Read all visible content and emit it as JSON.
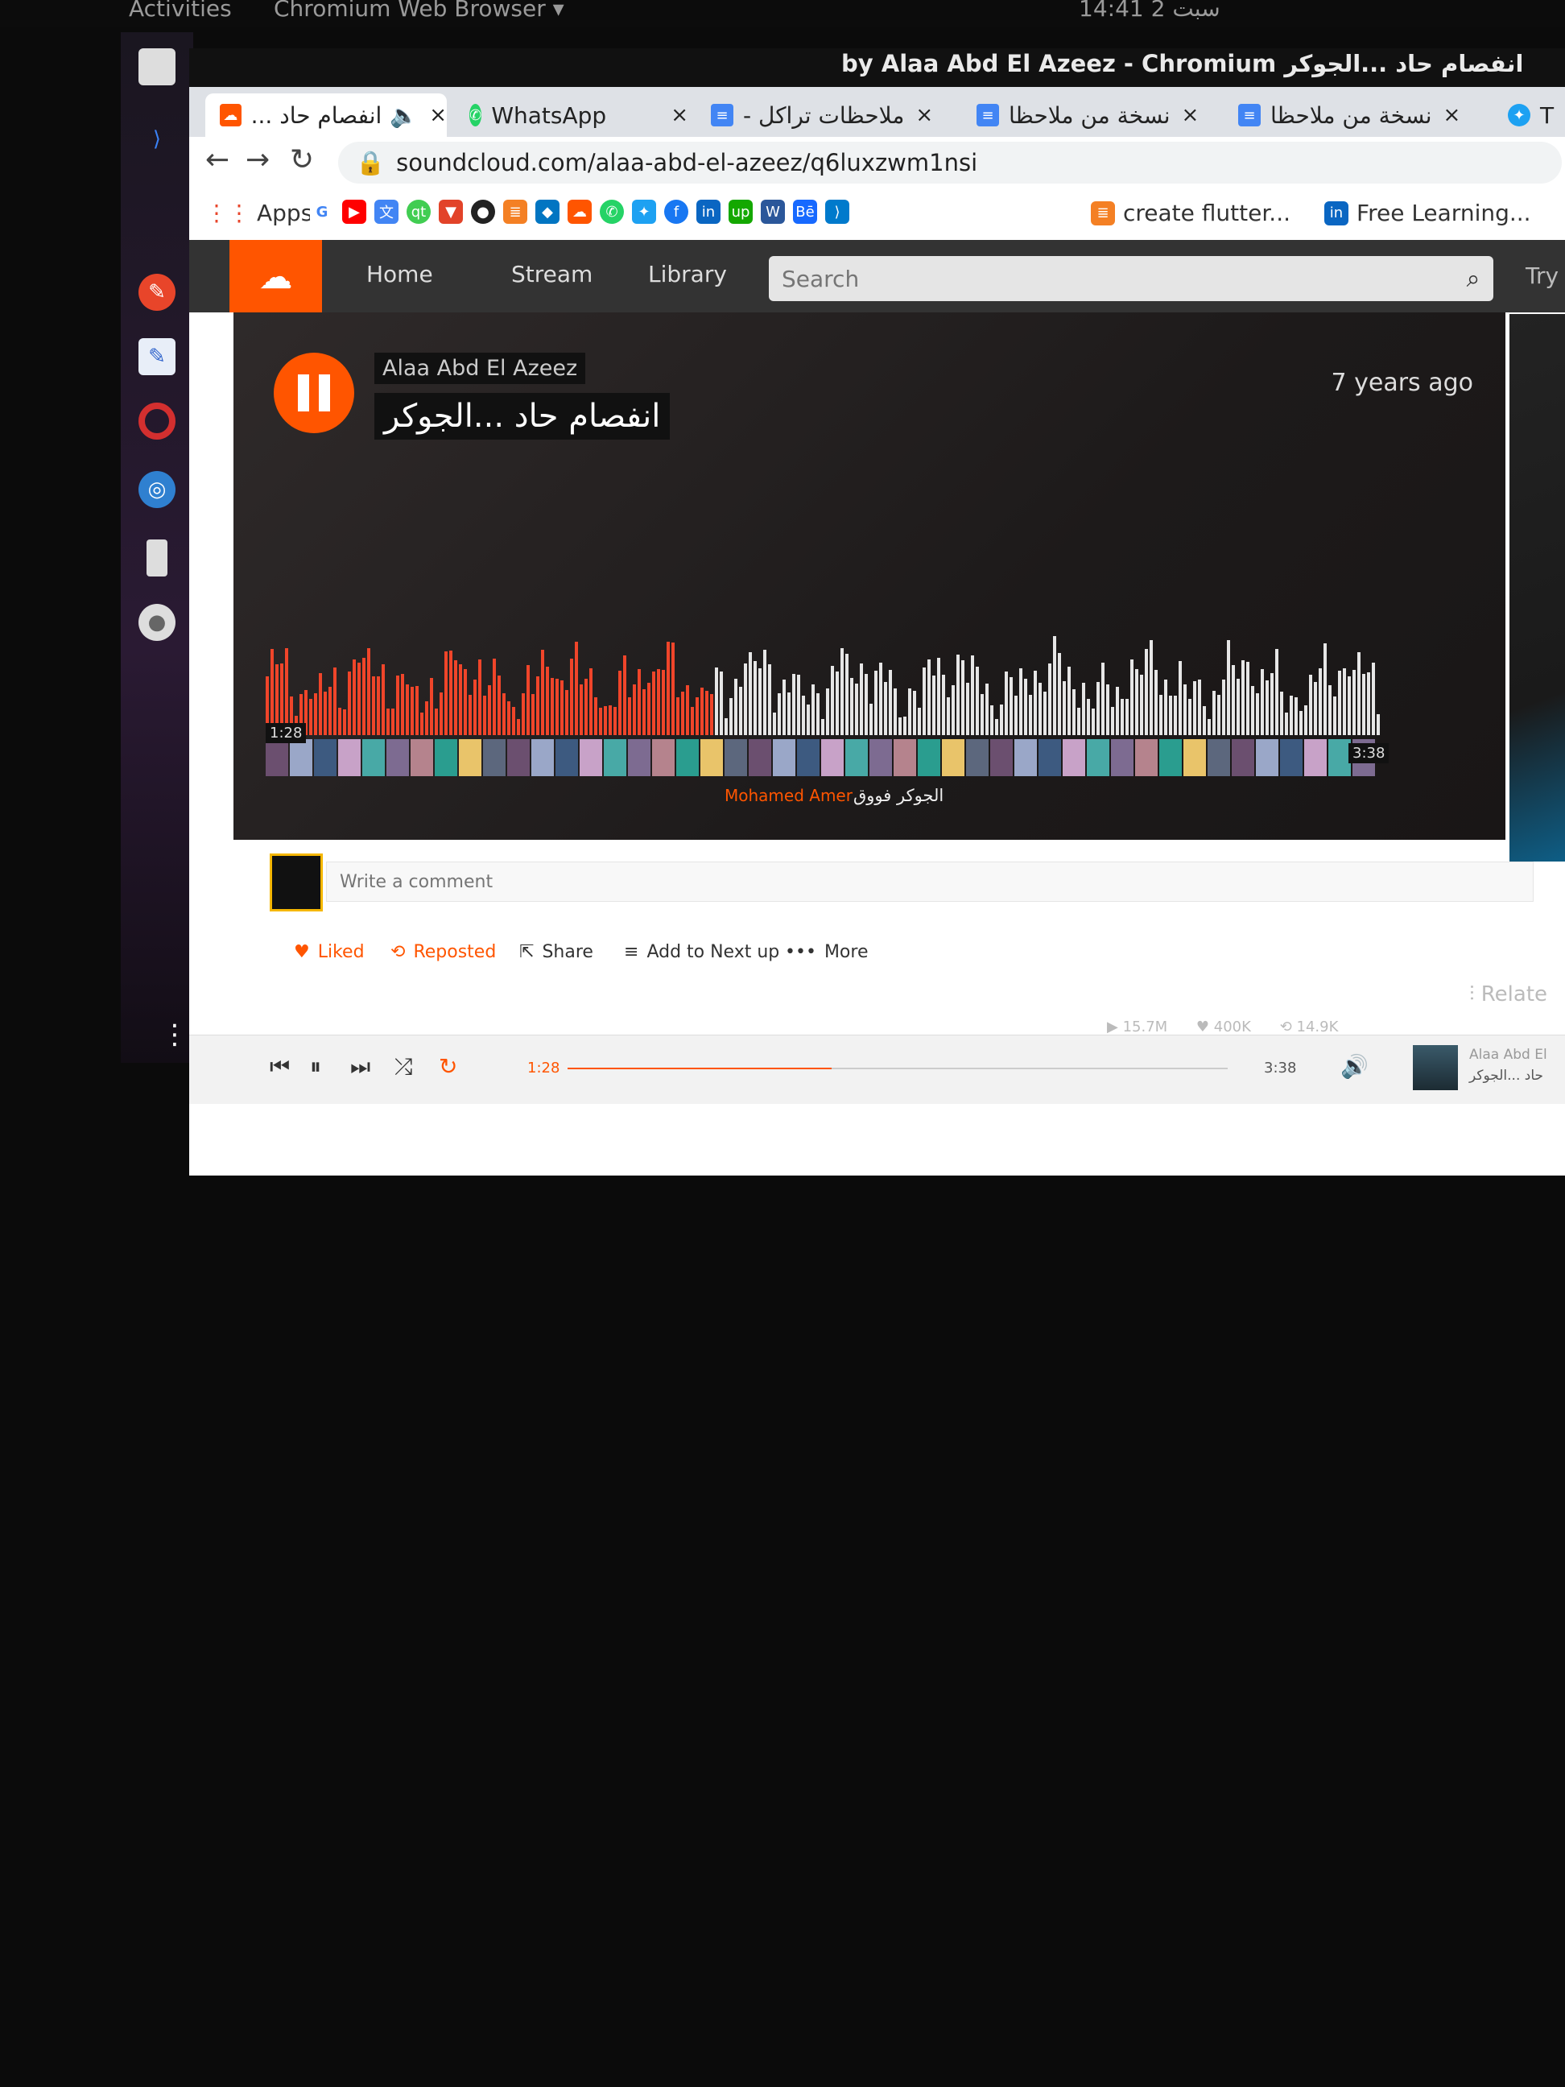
{
  "system": {
    "activities": "Activities",
    "app_menu": "Chromium Web Browser ▾",
    "clock": "14:41 2 سبت"
  },
  "window": {
    "title": "by Alaa Abd El Azeez - Chromium انفصام حاد ...الجوكر"
  },
  "tabs": [
    {
      "label": "انفصام حاد ...",
      "color": "#f50"
    },
    {
      "label": "WhatsApp",
      "color": "#25d366"
    },
    {
      "label": "ملاحظات تراكل -",
      "color": "#4285f4"
    },
    {
      "label": "نسخة من ملاحظا",
      "color": "#4285f4"
    },
    {
      "label": "نسخة من ملاحظا",
      "color": "#4285f4"
    },
    {
      "label": "T",
      "color": "#1da1f2"
    }
  ],
  "address_bar": {
    "url": "soundcloud.com/alaa-abd-el-azeez/q6luxzwm1nsi"
  },
  "bookmarks": {
    "apps_label": "Apps",
    "items": [
      {
        "label": "create flutter...",
        "icon": "stackoverflow-icon",
        "color": "#f48024"
      },
      {
        "label": "Free Learning...",
        "icon": "linkedin-icon",
        "color": "#0a66c2"
      }
    ]
  },
  "soundcloud": {
    "nav": {
      "home": "Home",
      "stream": "Stream",
      "library": "Library",
      "try": "Try"
    },
    "search_placeholder": "Search",
    "track": {
      "artist": "Alaa Abd El Azeez",
      "title": "انفصام حاد ...الجوكر",
      "posted": "7 years ago",
      "position": "1:28",
      "duration": "3:38",
      "progress_fraction": 0.4
    },
    "waveform_comment": {
      "user": "Mohamed Amer",
      "text": "الجوكر فووق"
    },
    "comment_placeholder": "Write a comment",
    "actions": {
      "liked": "Liked",
      "reposted": "Reposted",
      "share": "Share",
      "add_next": "Add to Next up",
      "more": "More"
    },
    "stats": {
      "plays": "15.7M",
      "likes": "400K",
      "reposts": "14.9K"
    },
    "related_label": "Relate",
    "now_playing": {
      "artist": "Alaa Abd El",
      "title": "حاد ...الجوكر"
    }
  },
  "colors": {
    "accent": "#f50",
    "played": "#f0452a",
    "unplayed": "#e6e6e6"
  }
}
